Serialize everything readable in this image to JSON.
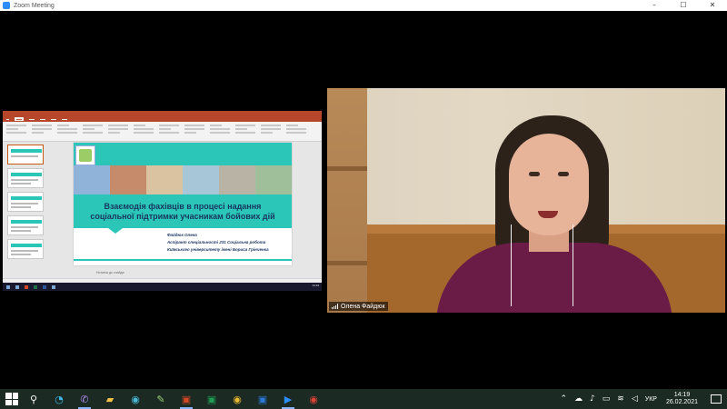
{
  "window": {
    "title": "Zoom Meeting",
    "controls": {
      "minimize": "–",
      "maximize": "☐",
      "close": "✕"
    }
  },
  "shared_screen": {
    "app": "PowerPoint",
    "slide": {
      "title_line1": "Взаємодія фахівців в процесі надання",
      "title_line2": "соціальної підтримки учасникам бойових дій",
      "author_line1": "Файдюк Олена",
      "author_line2": "Аспірант спеціальності 231 Соціальна робота",
      "author_line3": "Київського університету імені Бориса Грінченка"
    },
    "notes_placeholder": "Нотатки до слайда"
  },
  "participant": {
    "name": "Олена Файдюк"
  },
  "taskbar": {
    "apps": [
      "windows-start",
      "search",
      "edge",
      "viber",
      "file-explorer",
      "chrome-dev",
      "paint",
      "powerpoint",
      "excel",
      "chrome",
      "word",
      "zoom",
      "chrome-alt"
    ],
    "tray": {
      "language": "УКР",
      "time": "14:19",
      "date": "26.02.2021"
    }
  },
  "colors": {
    "slide_teal": "#2cc6b9",
    "title_navy": "#17375e",
    "ppt_red": "#b7472a",
    "zoom_blue": "#2d8cff",
    "taskbar": "#1b2a22"
  }
}
